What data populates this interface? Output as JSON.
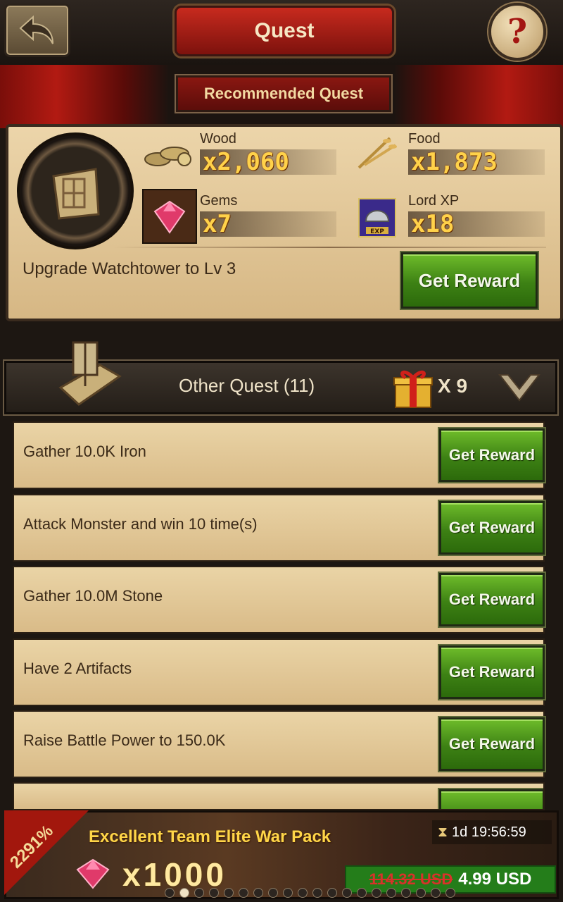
{
  "header": {
    "title": "Quest",
    "help_symbol": "?"
  },
  "recommended": {
    "title": "Recommended Quest",
    "rewards": [
      {
        "label": "Wood",
        "amount": "x2,060",
        "icon": "wood-logs-icon"
      },
      {
        "label": "Food",
        "amount": "x1,873",
        "icon": "wheat-icon"
      },
      {
        "label": "Gems",
        "amount": "x7",
        "icon": "gem-icon"
      },
      {
        "label": "Lord XP",
        "amount": "x18",
        "icon": "exp-helmet-icon"
      }
    ],
    "description": "Upgrade  Watchtower  to Lv 3",
    "button_label": "Get Reward"
  },
  "other_quests": {
    "title": "Other Quest  (11)",
    "gift_count": "X 9",
    "items": [
      {
        "text": "Gather 10.0K Iron",
        "button": "Get Reward"
      },
      {
        "text": "Attack  Monster  and win 10 time(s)",
        "button": "Get Reward"
      },
      {
        "text": "Gather 10.0M Stone",
        "button": "Get Reward"
      },
      {
        "text": "Have 2 Artifacts",
        "button": "Get Reward"
      },
      {
        "text": "Raise Battle Power to 150.0K",
        "button": "Get Reward"
      }
    ]
  },
  "promo": {
    "percent": "2291%",
    "title": "Excellent Team Elite War Pack",
    "quantity": "x1000",
    "timer": "1d 19:56:59",
    "old_price": "114.32 USD",
    "new_price": "4.99 USD",
    "page_count": 20,
    "active_page": 2
  },
  "colors": {
    "accent_green": "#3d8114",
    "title_red": "#c72a1e",
    "value_gold": "#ffd24a",
    "price_red": "#d8322a"
  }
}
